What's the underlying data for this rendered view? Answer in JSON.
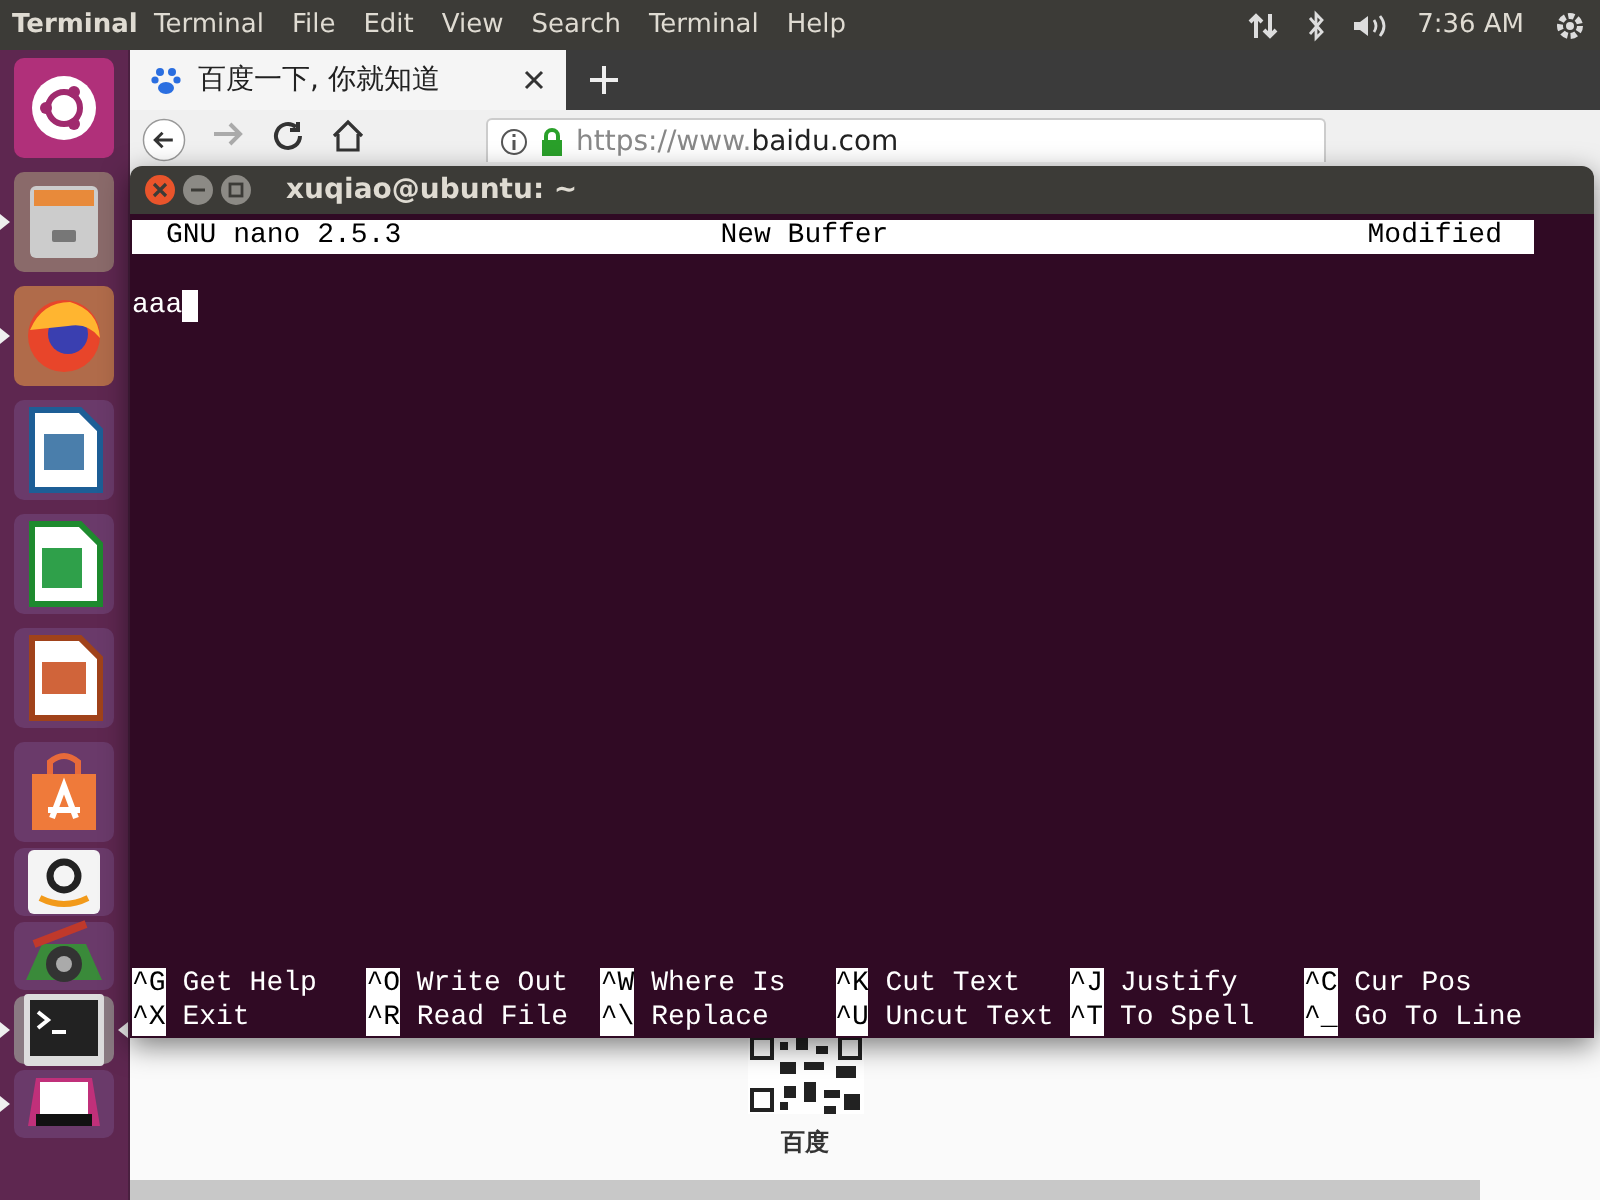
{
  "top_panel": {
    "app_name": "Terminal",
    "menu": [
      "Terminal",
      "File",
      "Edit",
      "View",
      "Search",
      "Terminal",
      "Help"
    ],
    "clock": "7:36 AM"
  },
  "launcher": {
    "items": [
      {
        "kind": "ubuntu",
        "running": false,
        "focused": false
      },
      {
        "kind": "files",
        "running": true,
        "focused": false
      },
      {
        "kind": "firefox",
        "running": true,
        "focused": false
      },
      {
        "kind": "writer",
        "running": false,
        "focused": false
      },
      {
        "kind": "calc",
        "running": false,
        "focused": false
      },
      {
        "kind": "impress",
        "running": false,
        "focused": false
      },
      {
        "kind": "software",
        "running": false,
        "focused": false
      },
      {
        "kind": "amazon",
        "running": false,
        "focused": false
      },
      {
        "kind": "settings",
        "running": false,
        "focused": false
      },
      {
        "kind": "terminal",
        "running": true,
        "focused": true
      },
      {
        "kind": "floppy",
        "running": true,
        "focused": false
      }
    ]
  },
  "browser": {
    "tab_title": "百度一下, 你就知道",
    "url_prefix": "https://www.",
    "url_host": "baidu.com",
    "page_caption": "百度"
  },
  "terminal": {
    "title": "xuqiao@ubuntu: ~",
    "header": {
      "version": "GNU nano 2.5.3",
      "buffer": "New Buffer",
      "status": "Modified"
    },
    "text": "aaa",
    "shortcuts": [
      [
        {
          "key": "^G",
          "label": "Get Help"
        },
        {
          "key": "^O",
          "label": "Write Out"
        },
        {
          "key": "^W",
          "label": "Where Is"
        },
        {
          "key": "^K",
          "label": "Cut Text"
        },
        {
          "key": "^J",
          "label": "Justify"
        },
        {
          "key": "^C",
          "label": "Cur Pos"
        }
      ],
      [
        {
          "key": "^X",
          "label": "Exit"
        },
        {
          "key": "^R",
          "label": "Read File"
        },
        {
          "key": "^\\",
          "label": "Replace"
        },
        {
          "key": "^U",
          "label": "Uncut Text"
        },
        {
          "key": "^T",
          "label": "To Spell"
        },
        {
          "key": "^_",
          "label": "Go To Line"
        }
      ]
    ]
  }
}
